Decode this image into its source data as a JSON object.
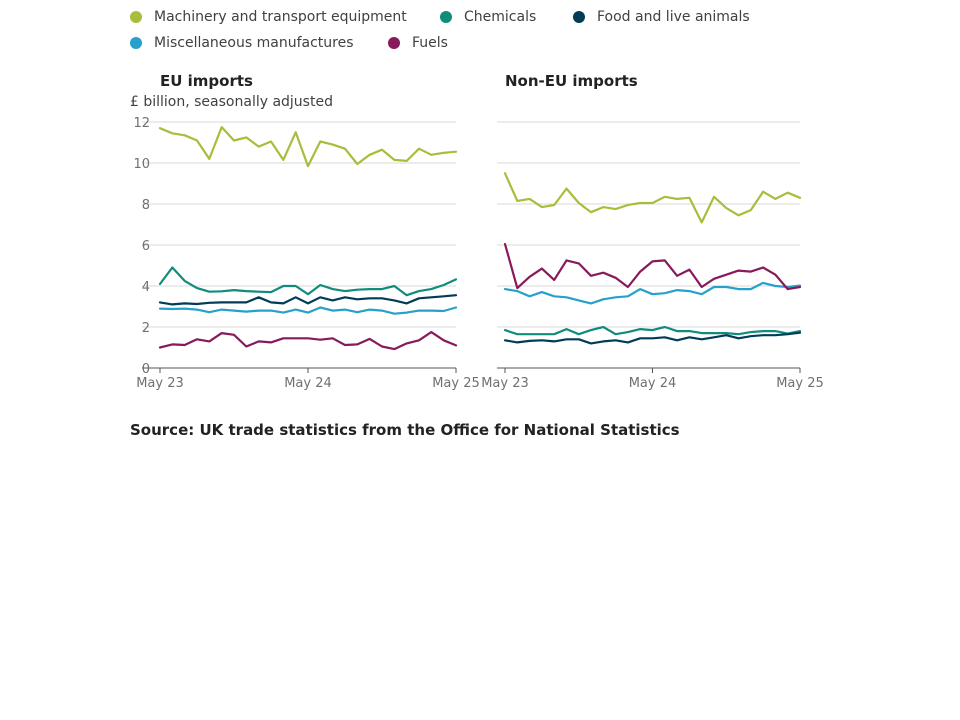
{
  "legend": {
    "items": [
      {
        "label": "Machinery and transport equipment",
        "color": "#a8bd3a"
      },
      {
        "label": "Chemicals",
        "color": "#118c7b"
      },
      {
        "label": "Food and live animals",
        "color": "#003c57"
      },
      {
        "label": "Miscellaneous manufactures",
        "color": "#27a0cc"
      },
      {
        "label": "Fuels",
        "color": "#871a5b"
      }
    ]
  },
  "subtitle": "£ billion, seasonally adjusted",
  "source": "Source: UK trade statistics from the Office for National Statistics",
  "chart_data": [
    {
      "type": "line",
      "title": "EU imports",
      "ylabel": "£ billion, seasonally adjusted",
      "ylim": [
        0,
        12
      ],
      "yticks": [
        "0",
        "2",
        "4",
        "6",
        "8",
        "10",
        "12"
      ],
      "xticks": [
        "May 23",
        "May 24",
        "May 25"
      ],
      "grid": true,
      "x_range": [
        "May 2023",
        "May 2025"
      ],
      "series": [
        {
          "name": "Machinery and transport equipment",
          "color": "#a8bd3a",
          "values": [
            11.7,
            11.45,
            11.35,
            11.1,
            10.2,
            11.75,
            11.1,
            11.25,
            10.8,
            11.05,
            10.15,
            11.5,
            9.85,
            11.05,
            10.9,
            10.7,
            9.95,
            10.4,
            10.65,
            10.15,
            10.1,
            10.7,
            10.4,
            10.5,
            10.55
          ]
        },
        {
          "name": "Chemicals",
          "color": "#118c7b",
          "values": [
            4.1,
            4.9,
            4.25,
            3.9,
            3.72,
            3.74,
            3.8,
            3.75,
            3.72,
            3.7,
            4.0,
            4.0,
            3.6,
            4.05,
            3.85,
            3.75,
            3.82,
            3.85,
            3.85,
            4.0,
            3.55,
            3.75,
            3.85,
            4.05,
            4.32
          ]
        },
        {
          "name": "Food and live animals",
          "color": "#003c57",
          "values": [
            3.2,
            3.1,
            3.15,
            3.12,
            3.18,
            3.2,
            3.2,
            3.2,
            3.45,
            3.2,
            3.15,
            3.45,
            3.15,
            3.45,
            3.3,
            3.45,
            3.35,
            3.4,
            3.4,
            3.3,
            3.15,
            3.4,
            3.45,
            3.5,
            3.55
          ]
        },
        {
          "name": "Miscellaneous manufactures",
          "color": "#27a0cc",
          "values": [
            2.9,
            2.88,
            2.9,
            2.85,
            2.72,
            2.85,
            2.8,
            2.75,
            2.8,
            2.8,
            2.7,
            2.85,
            2.7,
            2.95,
            2.8,
            2.85,
            2.72,
            2.85,
            2.8,
            2.65,
            2.7,
            2.8,
            2.8,
            2.78,
            2.95
          ]
        },
        {
          "name": "Fuels",
          "color": "#871a5b",
          "values": [
            1.0,
            1.15,
            1.12,
            1.4,
            1.3,
            1.7,
            1.62,
            1.05,
            1.3,
            1.25,
            1.45,
            1.45,
            1.45,
            1.38,
            1.45,
            1.12,
            1.15,
            1.42,
            1.05,
            0.92,
            1.2,
            1.35,
            1.75,
            1.35,
            1.1
          ]
        }
      ]
    },
    {
      "type": "line",
      "title": "Non-EU imports",
      "ylim": [
        0,
        12
      ],
      "xticks": [
        "May 23",
        "May 24",
        "May 25"
      ],
      "grid": true,
      "x_range": [
        "May 2023",
        "May 2025"
      ],
      "series": [
        {
          "name": "Machinery and transport equipment",
          "color": "#a8bd3a",
          "values": [
            9.5,
            8.15,
            8.25,
            7.85,
            7.95,
            8.75,
            8.05,
            7.6,
            7.85,
            7.75,
            7.95,
            8.05,
            8.05,
            8.35,
            8.25,
            8.3,
            7.1,
            8.35,
            7.8,
            7.45,
            7.7,
            8.6,
            8.25,
            8.55,
            8.3
          ]
        },
        {
          "name": "Chemicals",
          "color": "#118c7b",
          "values": [
            1.85,
            1.65,
            1.65,
            1.65,
            1.65,
            1.9,
            1.65,
            1.85,
            2.0,
            1.65,
            1.75,
            1.9,
            1.85,
            2.0,
            1.8,
            1.8,
            1.7,
            1.7,
            1.7,
            1.65,
            1.75,
            1.8,
            1.8,
            1.68,
            1.8
          ]
        },
        {
          "name": "Food and live animals",
          "color": "#003c57",
          "values": [
            1.35,
            1.25,
            1.32,
            1.35,
            1.3,
            1.4,
            1.4,
            1.2,
            1.3,
            1.35,
            1.25,
            1.45,
            1.45,
            1.5,
            1.35,
            1.5,
            1.4,
            1.5,
            1.6,
            1.45,
            1.55,
            1.6,
            1.6,
            1.65,
            1.72
          ]
        },
        {
          "name": "Miscellaneous manufactures",
          "color": "#27a0cc",
          "values": [
            3.85,
            3.75,
            3.5,
            3.7,
            3.5,
            3.45,
            3.3,
            3.15,
            3.35,
            3.45,
            3.5,
            3.85,
            3.6,
            3.65,
            3.8,
            3.75,
            3.6,
            3.95,
            3.95,
            3.85,
            3.85,
            4.15,
            4.0,
            3.95,
            4.02
          ]
        },
        {
          "name": "Fuels",
          "color": "#871a5b",
          "values": [
            6.05,
            3.9,
            4.45,
            4.85,
            4.3,
            5.25,
            5.1,
            4.5,
            4.65,
            4.4,
            3.95,
            4.7,
            5.2,
            5.25,
            4.5,
            4.8,
            3.95,
            4.35,
            4.55,
            4.75,
            4.7,
            4.9,
            4.55,
            3.85,
            3.95
          ]
        }
      ]
    }
  ]
}
